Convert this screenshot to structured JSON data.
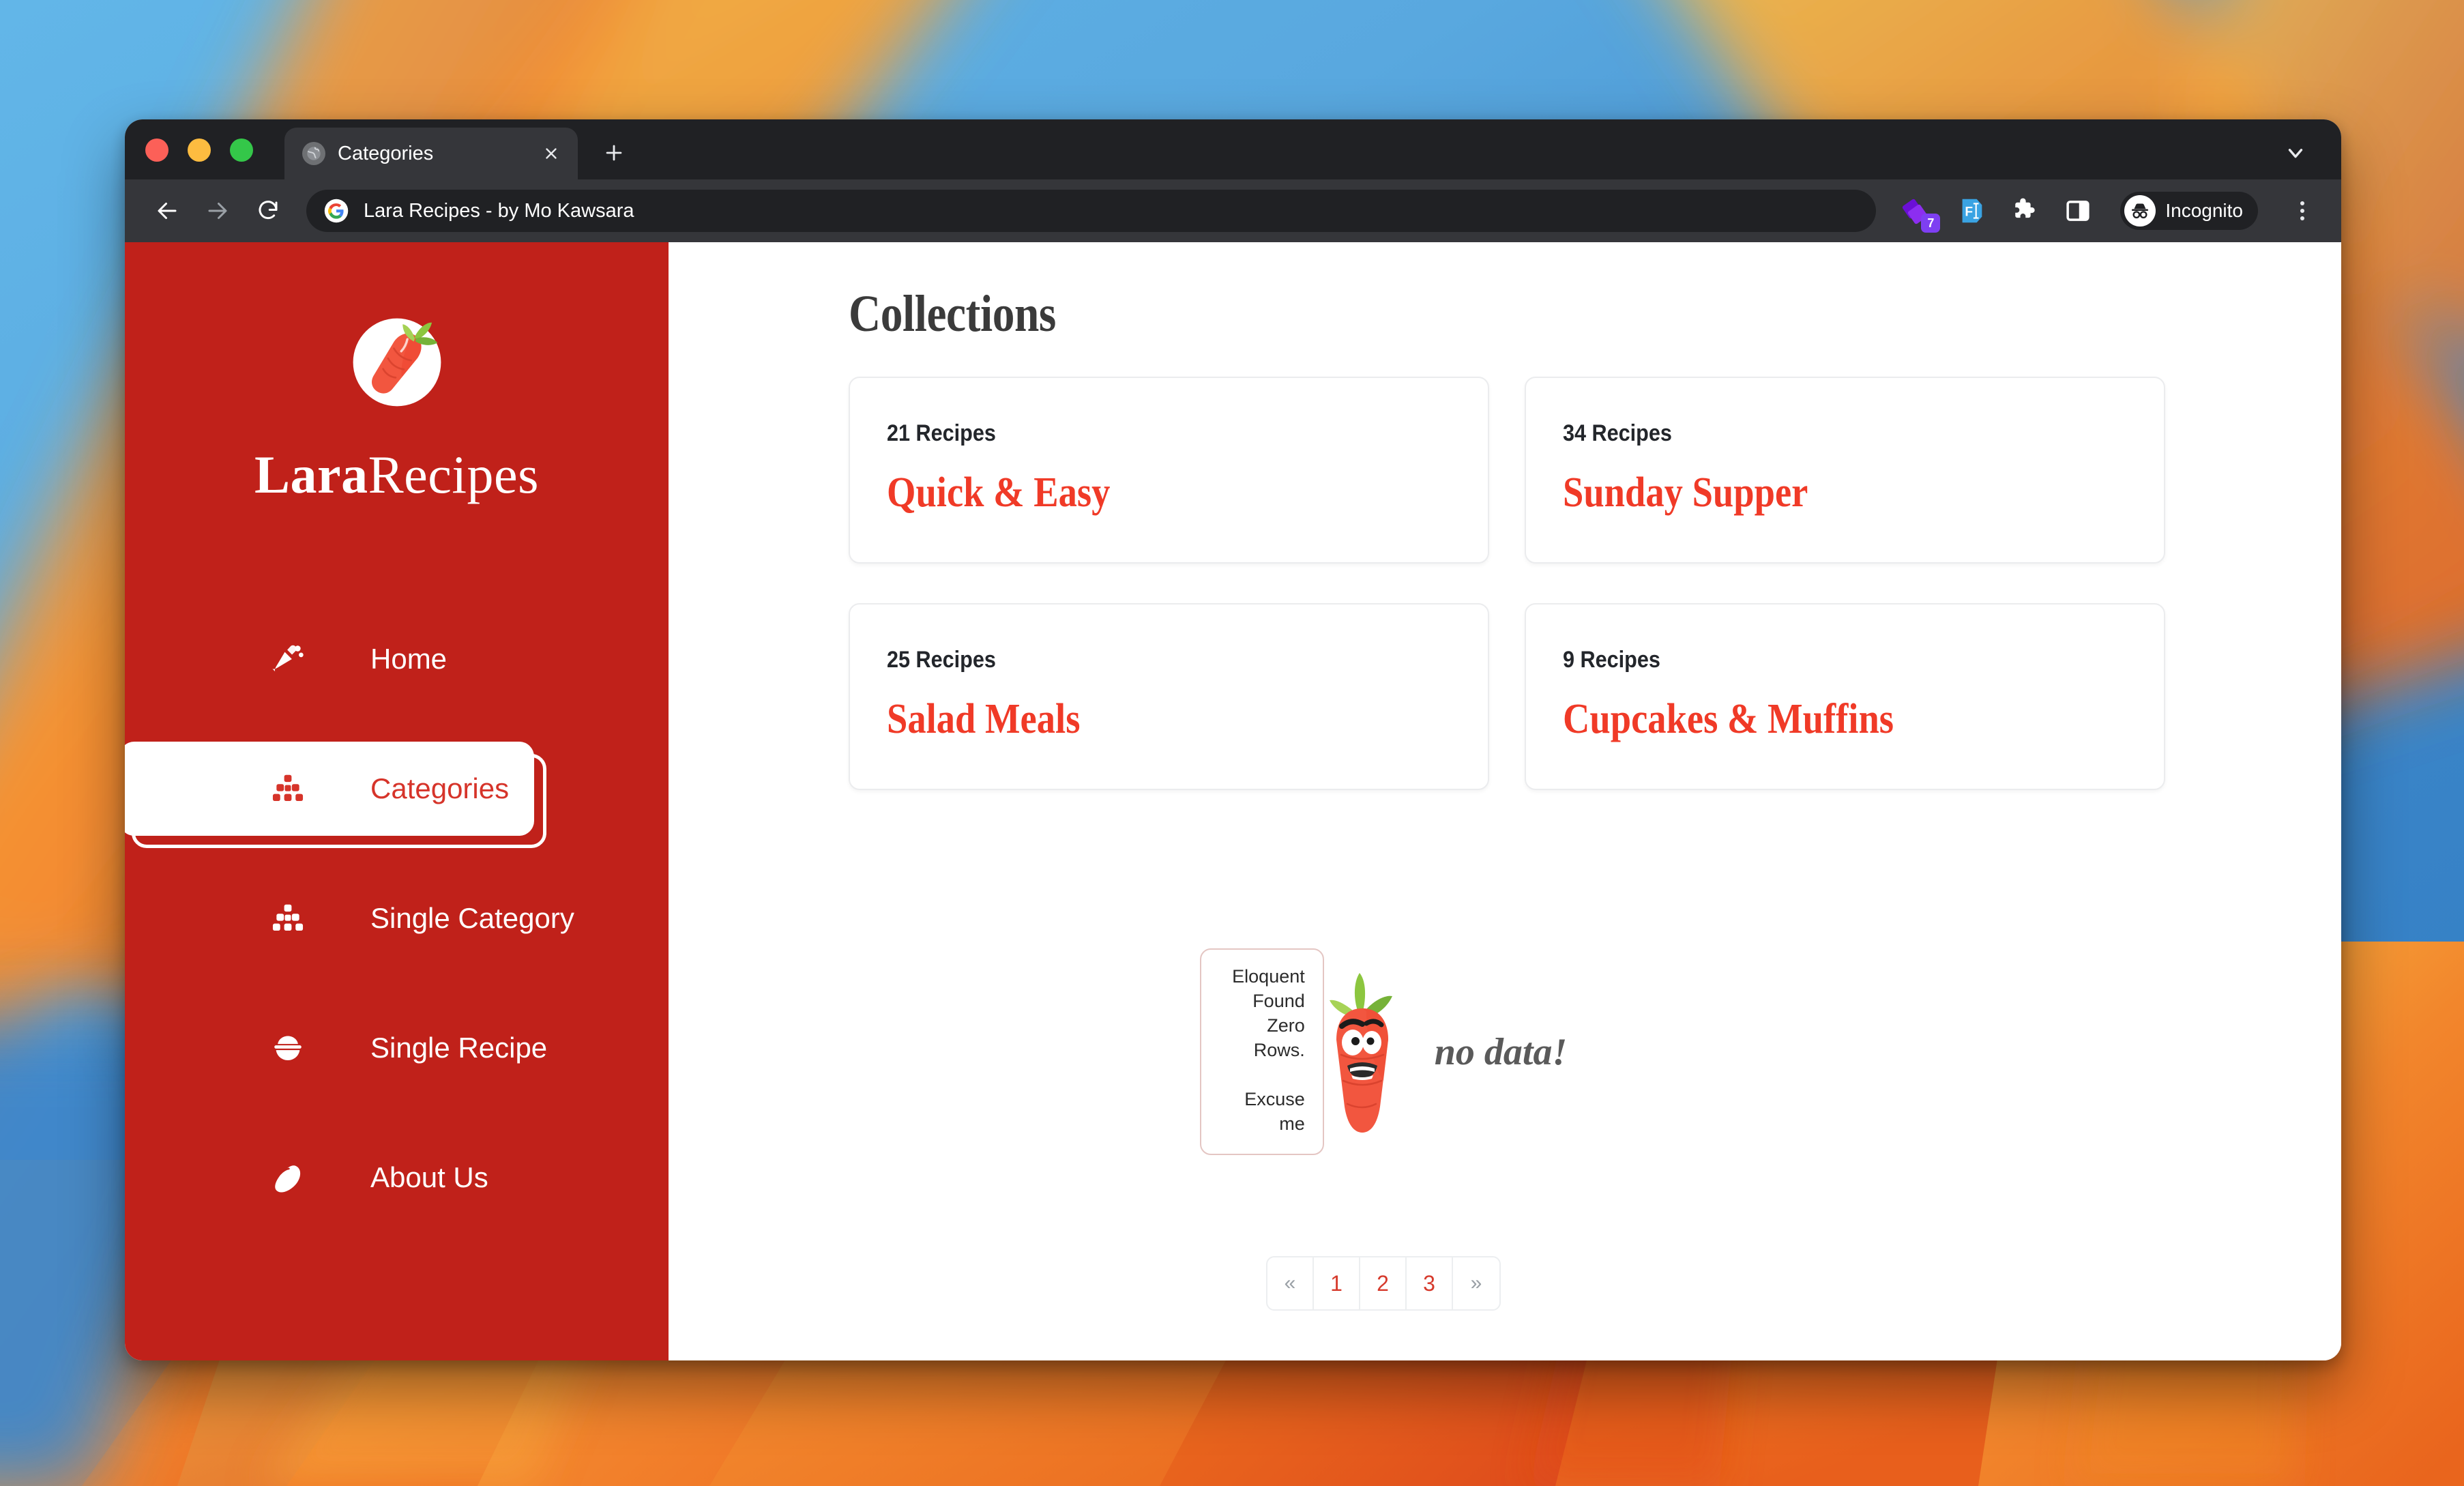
{
  "browser": {
    "tab": {
      "title": "Categories",
      "favicon_icon": "globe-icon",
      "close_icon": "close-icon"
    },
    "newtab_label": "+",
    "tabstrip_chevron_icon": "chevron-down-icon",
    "back_icon": "back-arrow-icon",
    "forward_icon": "forward-arrow-icon",
    "reload_icon": "reload-icon",
    "omnibox": {
      "value": "Lara Recipes - by Mo Kawsara",
      "site_icon": "google-icon"
    },
    "extensions": [
      {
        "name": "purple-diamond-extension-icon",
        "badge": "7"
      },
      {
        "name": "figma-extension-icon"
      },
      {
        "name": "puzzle-extensions-icon"
      },
      {
        "name": "side-panel-icon"
      }
    ],
    "profile": {
      "label": "Incognito",
      "icon": "incognito-icon"
    },
    "menu_icon": "kebab-menu-icon"
  },
  "sidebar": {
    "brand": {
      "logo_icon": "carrot-logo-icon",
      "name_bold": "Lara",
      "name_light": "Recipes"
    },
    "items": [
      {
        "label": "Home",
        "icon": "carrot-icon",
        "active": false
      },
      {
        "label": "Categories",
        "icon": "stacked-blocks-icon",
        "active": true
      },
      {
        "label": "Single Category",
        "icon": "stacked-blocks-icon",
        "active": false
      },
      {
        "label": "Single Recipe",
        "icon": "rice-bowl-icon",
        "active": false
      },
      {
        "label": "About Us",
        "icon": "lemon-icon",
        "active": false
      }
    ]
  },
  "main": {
    "title": "Collections",
    "cards": [
      {
        "count": "21 Recipes",
        "title": "Quick & Easy"
      },
      {
        "count": "34 Recipes",
        "title": "Sunday Supper"
      },
      {
        "count": "25 Recipes",
        "title": "Salad Meals"
      },
      {
        "count": "9 Recipes",
        "title": "Cupcakes & Muffins"
      }
    ],
    "empty_state": {
      "bubble_line1": "Eloquent Found Zero Rows.",
      "bubble_line2": "Excuse me",
      "caption": "no data!",
      "illustration_icon": "worried-carrot-icon"
    },
    "pagination": {
      "prev_label": "«",
      "next_label": "»",
      "pages": [
        "1",
        "2",
        "3"
      ]
    }
  },
  "colors": {
    "brand_red": "#c0211a",
    "accent_red": "#f03a27",
    "link_red": "#d63a2c",
    "heading_dark": "#3b3b3b"
  }
}
